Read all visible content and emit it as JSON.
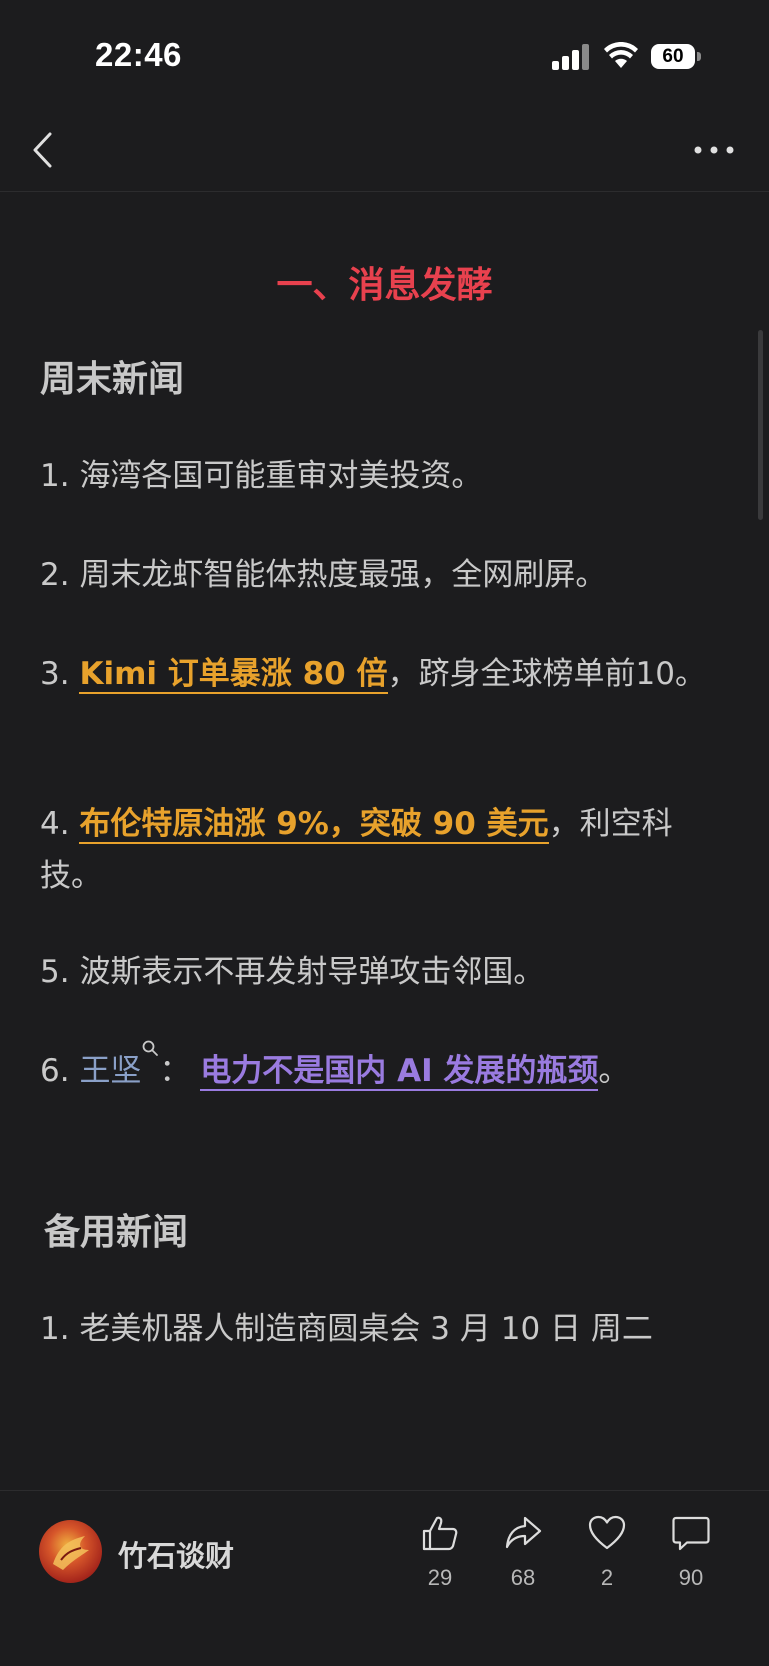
{
  "status_bar": {
    "time": "22:46",
    "battery_level": "60",
    "icons": [
      "signal-icon",
      "wifi-icon",
      "battery-icon"
    ]
  },
  "nav": {
    "back_icon": "chevron-left-icon",
    "more_icon": "more-horizontal-icon"
  },
  "article": {
    "section_title": "一、消息发酵",
    "weekend_news_heading": "周末新闻",
    "items": [
      {
        "number": "1.",
        "text": "海湾各国可能重审对美投资。"
      },
      {
        "number": "2.",
        "text": "周末龙虾智能体热度最强，全网刷屏。"
      },
      {
        "number": "3.",
        "highlight": "Kimi 订单暴涨 80 倍",
        "rest": "，跻身全球榜单前10。"
      },
      {
        "number": "4.",
        "highlight": "布伦特原油涨 9%，突破 90 美元",
        "rest": "，利空科技。"
      },
      {
        "number": "5.",
        "text": "波斯表示不再发射导弹攻击邻国。"
      },
      {
        "number": "6.",
        "link": "王坚",
        "separator": "：",
        "highlight": "电力不是国内 AI 发展的瓶颈",
        "rest": "。"
      }
    ],
    "backup_news_heading": "备用新闻",
    "backup_items": [
      {
        "number": "1.",
        "text": "老美机器人制造商圆桌会 3 月 10 日 周二"
      }
    ]
  },
  "colors": {
    "background": "#1c1c1e",
    "title_red": "#e8414e",
    "highlight_orange": "#e8a22c",
    "highlight_purple": "#9a7be0",
    "link_blue": "#8aa0c8"
  },
  "footer": {
    "author": "竹石谈财",
    "actions": [
      {
        "icon": "thumbs-up-icon",
        "count": "29"
      },
      {
        "icon": "share-icon",
        "count": "68"
      },
      {
        "icon": "heart-icon",
        "count": "2"
      },
      {
        "icon": "comment-icon",
        "count": "90"
      }
    ]
  }
}
